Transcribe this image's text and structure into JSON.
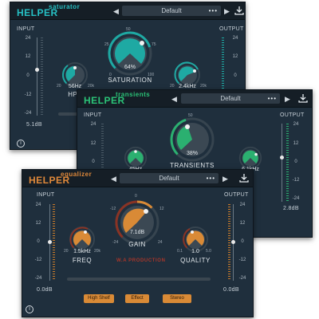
{
  "colors": {
    "saturator": "#1ea9a3",
    "transients": "#2bb070",
    "equalizer": "#d98a36",
    "panel": "#1f2f3d"
  },
  "saturator": {
    "logo": "HELPER",
    "subtitle": "saturator",
    "preset": "Default",
    "dots": "•••",
    "input_label": "INPUT",
    "output_label": "OUTPUT",
    "scale": [
      "24",
      "12",
      "0",
      "-12",
      "-24"
    ],
    "input_value": "5.1dB",
    "main_knob": {
      "name": "SATURATION",
      "value": "64%",
      "level_percent": 64,
      "min": "0",
      "max": "100",
      "ticks": [
        "25",
        "50",
        "75"
      ]
    },
    "left_knob": {
      "name": "HPF",
      "value": "56Hz",
      "min": "20",
      "max": "20k"
    },
    "right_knob": {
      "value": "2.4kHz",
      "min": "20",
      "max": "20k"
    },
    "icons": [
      "prev-arrow-icon",
      "next-arrow-icon",
      "download-icon",
      "info-icon"
    ]
  },
  "transients": {
    "logo": "HELPER",
    "subtitle": "transients",
    "preset": "Default",
    "dots": "•••",
    "input_label": "INPUT",
    "output_label": "OUTPUT",
    "scale": [
      "24",
      "12",
      "0",
      "-12",
      "-24"
    ],
    "output_value": "2.8dB",
    "main_knob": {
      "name": "TRANSIENTS",
      "value": "38%",
      "level_percent": 38,
      "min": "0",
      "max": "100",
      "ticks": [
        "25",
        "50",
        "75"
      ]
    },
    "left_knob": {
      "value": "45Hz"
    },
    "right_knob": {
      "value": "6.1kHz"
    }
  },
  "equalizer": {
    "logo": "HELPER",
    "subtitle": "equalizer",
    "preset": "Default",
    "dots": "•••",
    "input_label": "INPUT",
    "output_label": "OUTPUT",
    "scale": [
      "24",
      "12",
      "0",
      "-12",
      "-24"
    ],
    "input_value": "0.0dB",
    "output_value": "0.0dB",
    "main_knob": {
      "name": "GAIN",
      "value": "7.1dB",
      "min": "-24",
      "max": "24",
      "ticks": [
        "-12",
        "0",
        "12"
      ]
    },
    "left_knob": {
      "name": "FREQ",
      "value": "1.5kHz",
      "min": "20",
      "max": "20k"
    },
    "right_knob": {
      "name": "QUALITY",
      "value": "1.0",
      "min": "0.1",
      "max": "5.0"
    },
    "stamp": "W.A PRODUCTION",
    "buttons": [
      "High Shelf",
      "Effect",
      "Stereo"
    ]
  }
}
